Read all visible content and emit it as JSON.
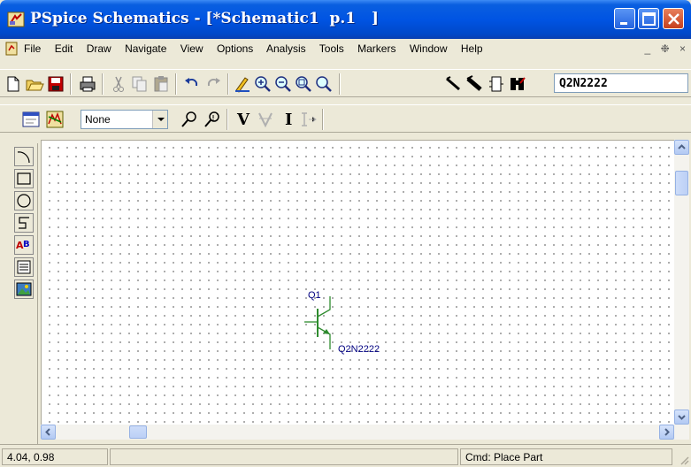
{
  "window": {
    "title": "PSpice Schematics - [*Schematic1  p.1   ]",
    "icon": "schematics-app-icon"
  },
  "menu": {
    "items": [
      "File",
      "Edit",
      "Draw",
      "Navigate",
      "View",
      "Options",
      "Analysis",
      "Tools",
      "Markers",
      "Window",
      "Help"
    ],
    "mdi_controls": [
      "_",
      "❉",
      "×"
    ]
  },
  "toolbar1": {
    "part_name": "Q2N2222"
  },
  "toolbar2": {
    "display_combo": "None",
    "voltage_marker": "V",
    "current_marker": "I"
  },
  "schematic": {
    "part_ref": "Q1",
    "part_value": "Q2N2222"
  },
  "status": {
    "coords": "4.04, 0.98",
    "command": "Cmd: Place Part"
  },
  "colors": {
    "titlebar": "#0054e3",
    "transistor": "#2e8b2e",
    "part_text": "#000080"
  }
}
